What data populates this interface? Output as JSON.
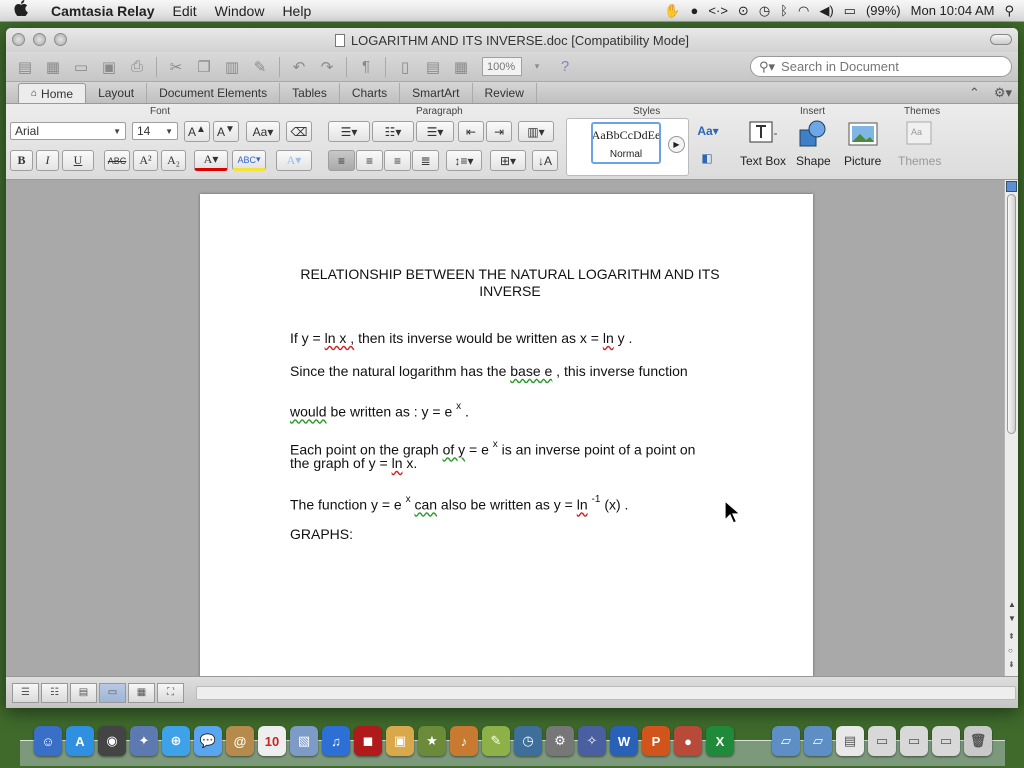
{
  "menubar": {
    "app_name": "Camtasia Relay",
    "items": [
      "Edit",
      "Window",
      "Help"
    ],
    "battery": "(99%)",
    "clock": "Mon 10:04 AM"
  },
  "window": {
    "title": "LOGARITHM AND ITS INVERSE.doc [Compatibility Mode]"
  },
  "toolbar": {
    "zoom": "100%",
    "search_placeholder": "Search in Document"
  },
  "ribbon": {
    "tabs": [
      "Home",
      "Layout",
      "Document Elements",
      "Tables",
      "Charts",
      "SmartArt",
      "Review"
    ],
    "active_tab": "Home",
    "groups": {
      "font": "Font",
      "paragraph": "Paragraph",
      "styles": "Styles",
      "insert": "Insert",
      "themes": "Themes"
    },
    "font_name": "Arial",
    "font_size": "14",
    "style_sample": "AaBbCcDdEe",
    "style_name": "Normal",
    "insert_buttons": [
      "Text Box",
      "Shape",
      "Picture"
    ],
    "themes_button": "Themes",
    "format_buttons": {
      "bold": "B",
      "italic": "I",
      "underline": "U",
      "strike": "ABC",
      "superscript": "A²",
      "subscript": "A₂",
      "font_color": "A",
      "highlight": "ABC",
      "grow": "A",
      "shrink": "A",
      "change_case": "Aa"
    }
  },
  "document": {
    "title": "RELATIONSHIP BETWEEN THE NATURAL LOGARITHM AND ITS INVERSE",
    "para1": {
      "a": "If y = ",
      "b": "ln x ,",
      "c": " then its inverse would be written as x = ",
      "d": "ln",
      "e": " y ."
    },
    "para2": {
      "a": "Since the natural logarithm has the ",
      "b": "base  e",
      "c": "  , this inverse function"
    },
    "para3": {
      "a": "would",
      "b": " be written as :  y = e ",
      "sup": "x",
      "c": " ."
    },
    "para4": {
      "a": "Each point on the graph ",
      "b": "of  y",
      "c": " = e ",
      "sup": "x",
      "d": "  is an inverse point of a point on",
      "e": "the graph of y = ",
      "f": "ln",
      "g": " x."
    },
    "para5": {
      "a": "The function y = e ",
      "sup1": "x",
      "b": "can",
      "c": " also be written as y = ",
      "d": "ln",
      "sup2": "-1",
      "e": " (x) ."
    },
    "para6": "GRAPHS:"
  }
}
